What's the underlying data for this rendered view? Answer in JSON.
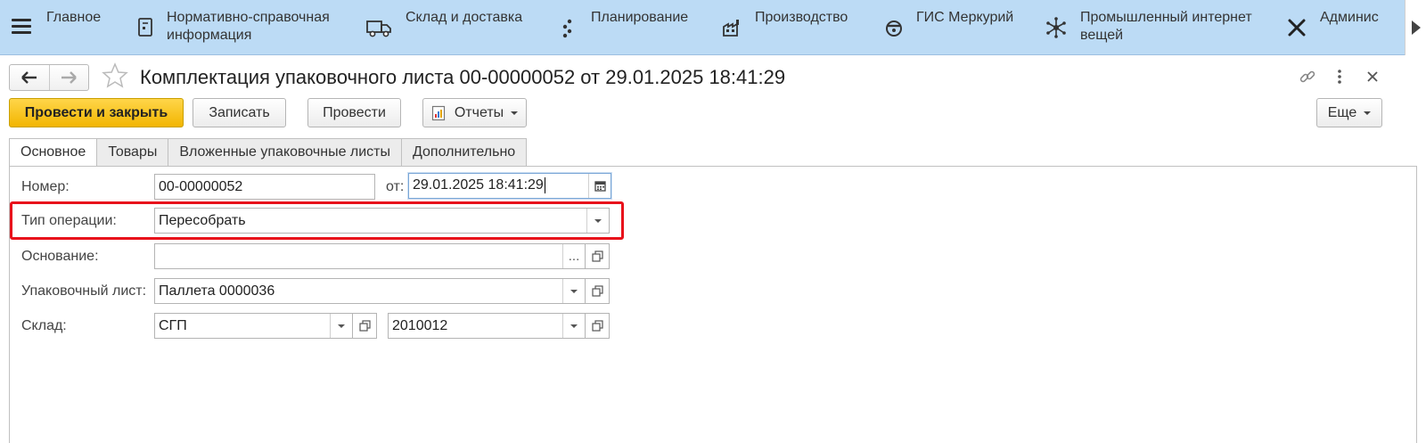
{
  "nav": {
    "items": [
      {
        "label": "Главное",
        "icon": "home-icon"
      },
      {
        "label": "Нормативно-справочная информация",
        "line1": "Нормативно-справочная",
        "line2": "информация",
        "icon": "book-icon"
      },
      {
        "label": "Склад и доставка",
        "icon": "truck-icon"
      },
      {
        "label": "Планирование",
        "icon": "dots-icon"
      },
      {
        "label": "Производство",
        "icon": "factory-icon"
      },
      {
        "label": "ГИС Меркурий",
        "icon": "mercury-icon"
      },
      {
        "label": "Промышленный интернет вещей",
        "line1": "Промышленный интернет",
        "line2": "вещей",
        "icon": "network-icon"
      },
      {
        "label": "Админис",
        "icon": "tools-icon"
      }
    ]
  },
  "document": {
    "title": "Комплектация упаковочного листа 00-00000052 от 29.01.2025 18:41:29"
  },
  "toolbar": {
    "post_close": "Провести и закрыть",
    "save": "Записать",
    "post": "Провести",
    "reports": "Отчеты",
    "more": "Еще"
  },
  "tabs": [
    {
      "label": "Основное",
      "active": true
    },
    {
      "label": "Товары",
      "active": false
    },
    {
      "label": "Вложенные упаковочные листы",
      "active": false
    },
    {
      "label": "Дополнительно",
      "active": false
    }
  ],
  "form": {
    "number_label": "Номер:",
    "number_value": "00-00000052",
    "date_label": "от:",
    "date_value": "29.01.2025 18:41:29",
    "operation_label": "Тип операции:",
    "operation_value": "Пересобрать",
    "basis_label": "Основание:",
    "basis_value": "",
    "basis_button": "...",
    "packlist_label": "Упаковочный лист:",
    "packlist_value": "Паллета 0000036",
    "warehouse_label": "Склад:",
    "warehouse_value": "СГП",
    "cell_value": "2010012"
  },
  "colors": {
    "nav_bg": "#bcdbf5",
    "primary_button": "#f2b500",
    "highlight": "#e8111b"
  }
}
